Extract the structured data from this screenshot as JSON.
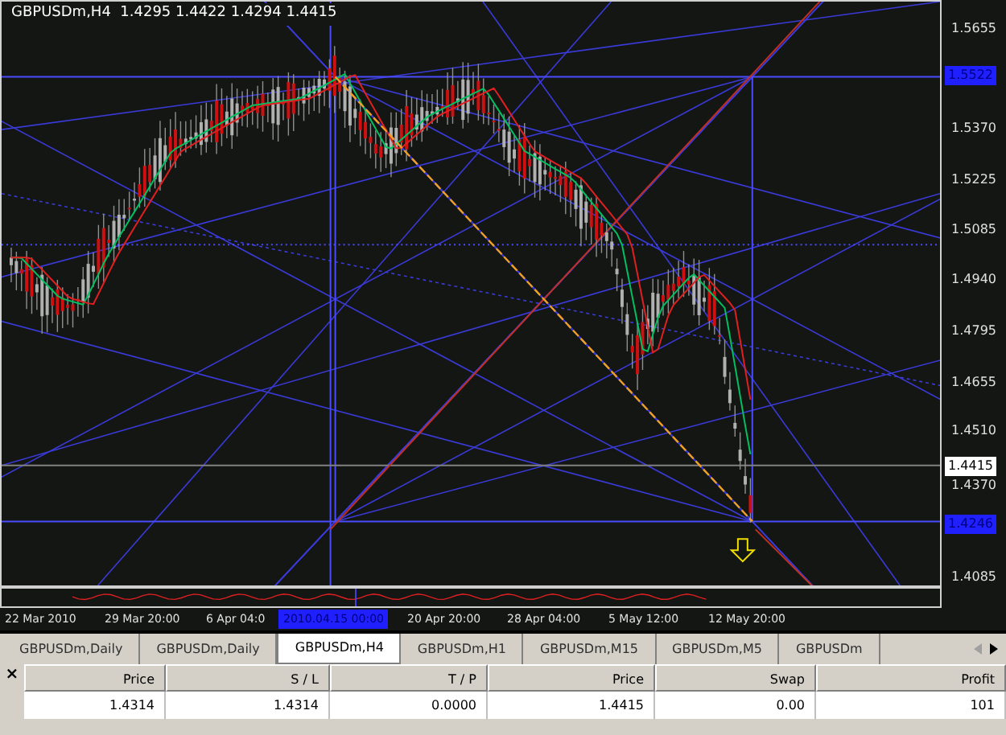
{
  "chart": {
    "header": "GBPUSDm,H4  1.4295 1.4422 1.4294 1.4415",
    "price_axis": [
      "1.5655",
      "1.5370",
      "1.5225",
      "1.5085",
      "1.4940",
      "1.4795",
      "1.4655",
      "1.4510",
      "1.4370",
      "1.4085"
    ],
    "price_markers": [
      {
        "label": "1.5522",
        "kind": "line"
      },
      {
        "label": "1.4415",
        "kind": "bid"
      },
      {
        "label": "1.4246",
        "kind": "line"
      }
    ],
    "time_axis": [
      "22 Mar 2010",
      "29 Mar 20:00",
      "6 Apr 04:0",
      "20 Apr 20:00",
      "28 Apr 04:00",
      "5 May 12:00",
      "12 May 20:00"
    ],
    "time_cursor": "2010.04.15 00:00"
  },
  "tabs": [
    {
      "label": "GBPUSDm,Daily",
      "selected": false
    },
    {
      "label": "GBPUSDm,Daily",
      "selected": false
    },
    {
      "label": "GBPUSDm,H4",
      "selected": true
    },
    {
      "label": "GBPUSDm,H1",
      "selected": false
    },
    {
      "label": "GBPUSDm,M15",
      "selected": false
    },
    {
      "label": "GBPUSDm,M5",
      "selected": false
    },
    {
      "label": "GBPUSDm",
      "selected": false
    }
  ],
  "terminal": {
    "close": "×",
    "columns": [
      "Price",
      "S / L",
      "T / P",
      "Price",
      "Swap",
      "Profit"
    ],
    "rows": [
      [
        "1.4314",
        "1.4314",
        "0.0000",
        "1.4415",
        "0.00",
        "101"
      ]
    ]
  }
}
